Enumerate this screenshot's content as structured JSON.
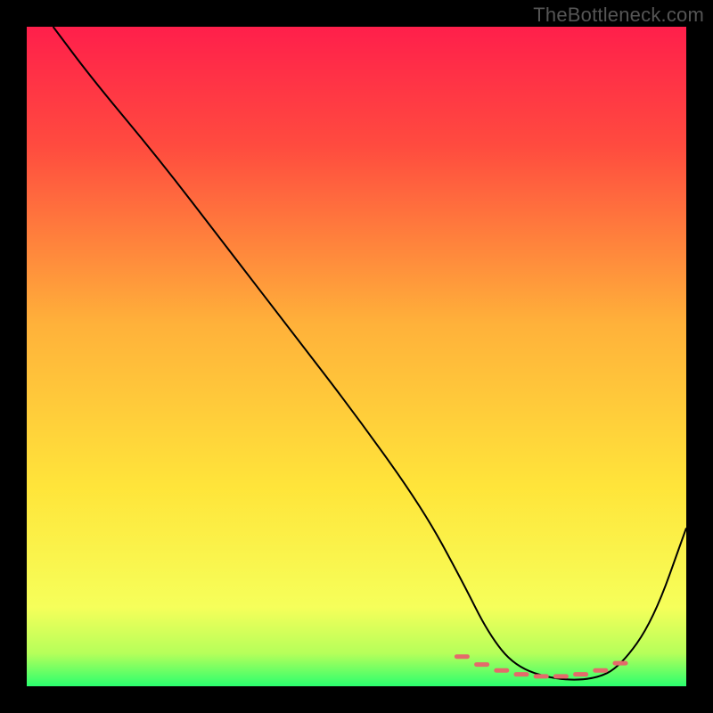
{
  "watermark": "TheBottleneck.com",
  "colors": {
    "frame_bg": "#000000",
    "gradient_stops": [
      {
        "offset": "0%",
        "color": "#ff1f4b"
      },
      {
        "offset": "18%",
        "color": "#ff4b3f"
      },
      {
        "offset": "45%",
        "color": "#ffb13a"
      },
      {
        "offset": "70%",
        "color": "#ffe53a"
      },
      {
        "offset": "88%",
        "color": "#f6ff5a"
      },
      {
        "offset": "95%",
        "color": "#b6ff5a"
      },
      {
        "offset": "100%",
        "color": "#2bff6e"
      }
    ],
    "curve": "#000000",
    "tick": "#e46a6a"
  },
  "chart_data": {
    "type": "line",
    "title": "",
    "xlabel": "",
    "ylabel": "",
    "x_range": [
      0,
      100
    ],
    "y_range": [
      0,
      100
    ],
    "series": [
      {
        "name": "bottleneck_curve",
        "x": [
          4,
          10,
          20,
          30,
          40,
          50,
          60,
          66,
          70,
          74,
          80,
          86,
          90,
          95,
          100
        ],
        "y": [
          100,
          92,
          80,
          67,
          54,
          41,
          27,
          16,
          8,
          3,
          1,
          1,
          3,
          10,
          24
        ]
      }
    ],
    "optimal_zone": {
      "x": [
        66,
        69,
        72,
        75,
        78,
        81,
        84,
        87,
        90
      ],
      "y": [
        4.5,
        3.3,
        2.4,
        1.8,
        1.5,
        1.5,
        1.8,
        2.4,
        3.5
      ]
    },
    "gradient_meaning": "vertical color = bottleneck severity (red=high, green=none)"
  }
}
